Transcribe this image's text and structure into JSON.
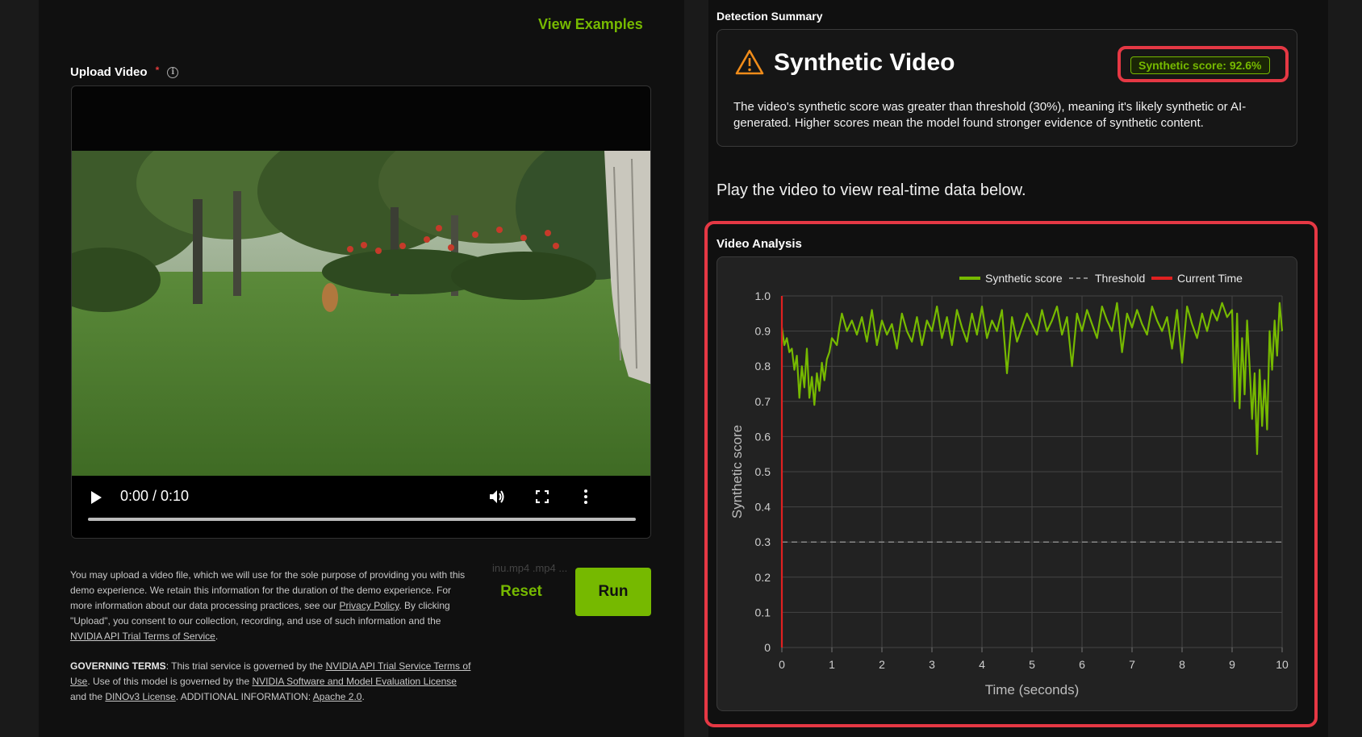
{
  "header": {
    "view_examples": "View Examples"
  },
  "upload": {
    "label": "Upload Video",
    "required_mark": "*",
    "info_icon": "info-icon"
  },
  "player": {
    "time": "0:00 / 0:10",
    "progress": 0.0,
    "icons": [
      "play-icon",
      "volume-icon",
      "fullscreen-icon",
      "more-options-icon"
    ]
  },
  "file_hint": "inu.mp4 .mp4 ...",
  "disclaimer": {
    "p1_a": "You may upload a video file, which we will use for the sole purpose of providing you with this demo experience. We retain this information for the duration of the demo experience. For more information about our data processing practices, see our ",
    "privacy_link": "Privacy Policy",
    "p1_b": ". By clicking \"Upload\", you consent to our collection, recording, and use of such information and the ",
    "api_terms_link": "NVIDIA API Trial Terms of Service",
    "p1_c": ".",
    "gov_label": "GOVERNING TERMS",
    "gov_a": ": This trial service is governed by the ",
    "gov_link1": "NVIDIA API Trial Service Terms of Use",
    "gov_b": ". Use of this model is governed by the ",
    "gov_link2": "NVIDIA Software and Model Evaluation License",
    "gov_c": " and the ",
    "gov_link3": "DINOv3 License",
    "gov_d": ". ADDITIONAL INFORMATION: ",
    "gov_link4": "Apache 2.0",
    "gov_e": "."
  },
  "actions": {
    "reset": "Reset",
    "run": "Run"
  },
  "summary": {
    "section_title": "Detection Summary",
    "verdict": "Synthetic Video",
    "score_badge": "Synthetic score: 92.6%",
    "description": "The video's synthetic score was greater than threshold (30%), meaning it's likely synthetic or AI-generated. Higher scores mean the model found stronger evidence of synthetic content.",
    "icon": "warning-icon"
  },
  "play_hint": "Play the video to view real-time data below.",
  "analysis": {
    "section_title": "Video Analysis"
  },
  "colors": {
    "accent": "#76b900",
    "highlight": "#e53844",
    "current_time": "#e02020"
  },
  "chart_data": {
    "type": "line",
    "xlabel": "Time (seconds)",
    "ylabel": "Synthetic score",
    "xlim": [
      0,
      10
    ],
    "ylim": [
      0,
      1.0
    ],
    "x_ticks": [
      0,
      1,
      2,
      3,
      4,
      5,
      6,
      7,
      8,
      9,
      10
    ],
    "y_ticks": [
      0,
      0.1,
      0.2,
      0.3,
      0.4,
      0.5,
      0.6,
      0.7,
      0.8,
      0.9,
      1.0
    ],
    "y_tick_labels": [
      "0",
      "0.1",
      "0.2",
      "0.3",
      "0.4",
      "0.5",
      "0.6",
      "0.7",
      "0.8",
      "0.9",
      "1.0"
    ],
    "legend": [
      "Synthetic score",
      "Threshold",
      "Current Time"
    ],
    "legend_position": "top-right",
    "grid": true,
    "threshold": 0.3,
    "current_time": 0,
    "series": [
      {
        "name": "Synthetic score",
        "x": [
          0.0,
          0.05,
          0.1,
          0.15,
          0.2,
          0.25,
          0.3,
          0.35,
          0.4,
          0.45,
          0.5,
          0.55,
          0.6,
          0.65,
          0.7,
          0.75,
          0.8,
          0.85,
          0.9,
          0.95,
          1.0,
          1.1,
          1.15,
          1.2,
          1.3,
          1.4,
          1.5,
          1.6,
          1.7,
          1.8,
          1.9,
          2.0,
          2.1,
          2.2,
          2.3,
          2.4,
          2.5,
          2.6,
          2.7,
          2.8,
          2.9,
          3.0,
          3.1,
          3.2,
          3.3,
          3.4,
          3.5,
          3.6,
          3.7,
          3.8,
          3.9,
          4.0,
          4.1,
          4.2,
          4.3,
          4.4,
          4.5,
          4.6,
          4.7,
          4.8,
          4.9,
          5.0,
          5.1,
          5.2,
          5.3,
          5.4,
          5.5,
          5.6,
          5.7,
          5.8,
          5.9,
          6.0,
          6.1,
          6.2,
          6.3,
          6.4,
          6.5,
          6.6,
          6.7,
          6.8,
          6.9,
          7.0,
          7.1,
          7.2,
          7.3,
          7.4,
          7.5,
          7.6,
          7.7,
          7.8,
          7.9,
          8.0,
          8.1,
          8.2,
          8.3,
          8.4,
          8.5,
          8.6,
          8.7,
          8.8,
          8.9,
          9.0,
          9.05,
          9.1,
          9.15,
          9.2,
          9.25,
          9.3,
          9.35,
          9.4,
          9.45,
          9.5,
          9.55,
          9.6,
          9.65,
          9.7,
          9.75,
          9.8,
          9.85,
          9.9,
          9.95,
          10.0
        ],
        "values": [
          0.91,
          0.86,
          0.88,
          0.84,
          0.85,
          0.79,
          0.83,
          0.71,
          0.8,
          0.74,
          0.85,
          0.71,
          0.77,
          0.69,
          0.78,
          0.73,
          0.81,
          0.76,
          0.82,
          0.84,
          0.88,
          0.86,
          0.91,
          0.95,
          0.9,
          0.93,
          0.89,
          0.94,
          0.87,
          0.96,
          0.86,
          0.93,
          0.89,
          0.92,
          0.85,
          0.95,
          0.9,
          0.87,
          0.94,
          0.86,
          0.93,
          0.9,
          0.97,
          0.88,
          0.94,
          0.86,
          0.96,
          0.91,
          0.87,
          0.95,
          0.89,
          0.97,
          0.88,
          0.93,
          0.9,
          0.96,
          0.78,
          0.94,
          0.87,
          0.91,
          0.95,
          0.92,
          0.89,
          0.96,
          0.9,
          0.93,
          0.97,
          0.89,
          0.94,
          0.8,
          0.95,
          0.9,
          0.96,
          0.92,
          0.88,
          0.97,
          0.93,
          0.9,
          0.98,
          0.84,
          0.95,
          0.91,
          0.96,
          0.92,
          0.89,
          0.97,
          0.93,
          0.9,
          0.94,
          0.85,
          0.96,
          0.81,
          0.97,
          0.92,
          0.88,
          0.95,
          0.9,
          0.96,
          0.93,
          0.98,
          0.94,
          0.96,
          0.7,
          0.95,
          0.68,
          0.88,
          0.72,
          0.93,
          0.8,
          0.65,
          0.78,
          0.55,
          0.79,
          0.63,
          0.76,
          0.62,
          0.9,
          0.79,
          0.93,
          0.83,
          0.98,
          0.9
        ]
      }
    ]
  }
}
